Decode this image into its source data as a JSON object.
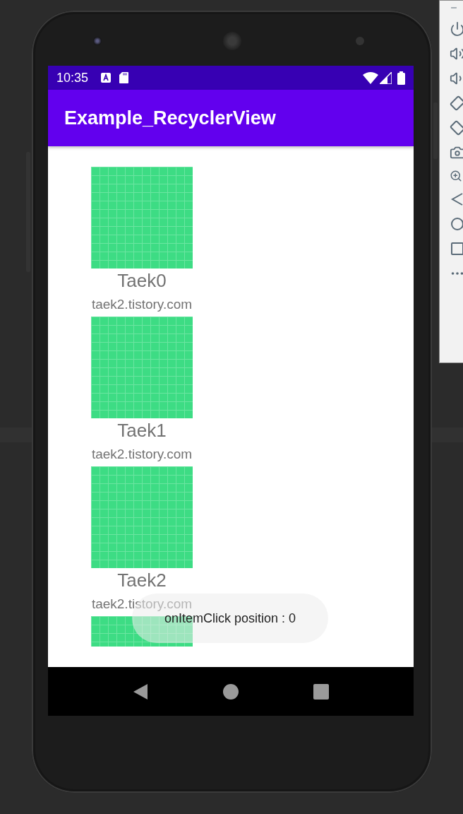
{
  "status_bar": {
    "time": "10:35"
  },
  "app_bar": {
    "title": "Example_RecyclerView"
  },
  "items": [
    {
      "kind": "full",
      "title": "Taek0",
      "subtitle": "taek2.tistory.com"
    },
    {
      "kind": "full",
      "title": "Taek1",
      "subtitle": "taek2.tistory.com"
    },
    {
      "kind": "full",
      "title": "Taek2",
      "subtitle": "taek2.tistory.com"
    },
    {
      "kind": "partial"
    }
  ],
  "toast": {
    "text": "onItemClick position : 0"
  }
}
